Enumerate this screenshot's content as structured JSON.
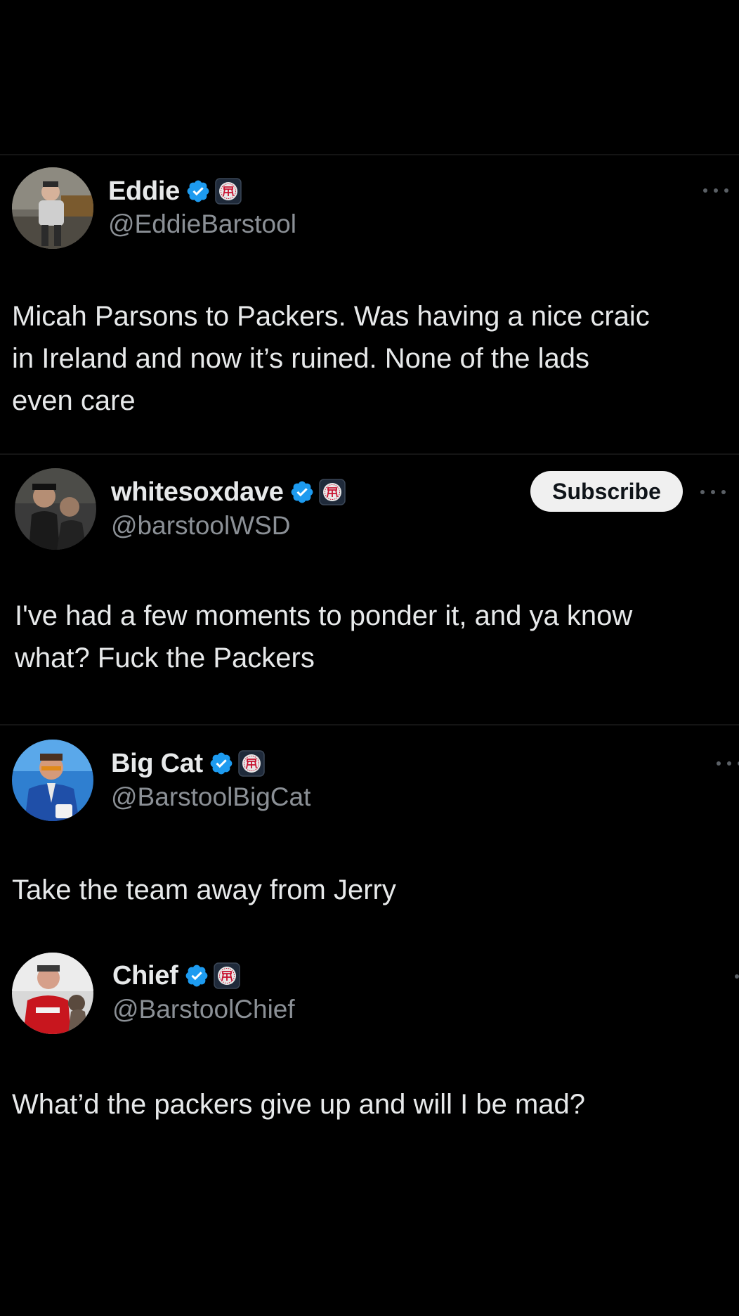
{
  "tweets": [
    {
      "name": "Eddie",
      "handle": "@EddieBarstool",
      "text": "Micah Parsons to Packers. Was having a nice craic\nin Ireland and now it’s ruined. None of the lads\neven care"
    },
    {
      "name": "whitesoxdave",
      "handle": "@barstoolWSD",
      "subscribe_label": "Subscribe",
      "text": "I've had a few moments to ponder it, and ya know\nwhat? Fuck the Packers"
    },
    {
      "name": "Big Cat",
      "handle": "@BarstoolBigCat",
      "text": "Take the team away from Jerry"
    },
    {
      "name": "Chief",
      "handle": "@BarstoolChief",
      "text": "What’d the packers give up and will I be mad?"
    }
  ],
  "icons": {
    "verified": "verified-badge-icon",
    "affiliation": "barstool-stool-icon",
    "more": "more-options-icon"
  },
  "colors": {
    "background": "#000000",
    "text": "#e7e9ea",
    "handle": "#8b9096",
    "verified": "#1d9bf0",
    "subscribe_bg": "#f0f0f0"
  }
}
